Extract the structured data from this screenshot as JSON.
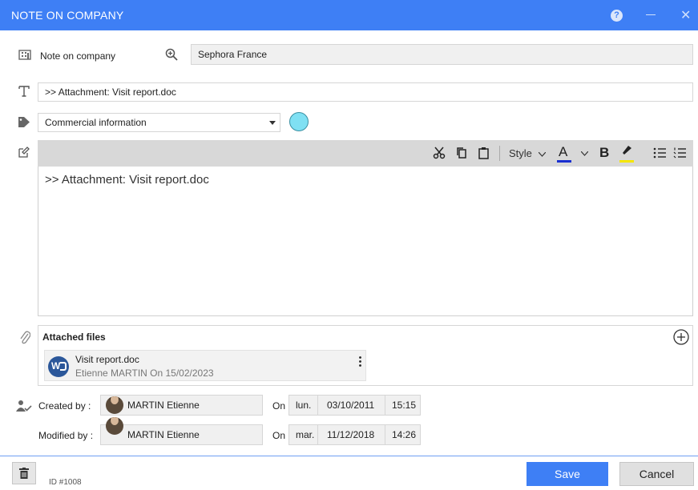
{
  "window": {
    "title": "NOTE ON COMPANY",
    "help_glyph": "?",
    "close_glyph": "✕"
  },
  "company": {
    "label": "Note on company",
    "value": "Sephora France"
  },
  "subject": {
    "value": ">> Attachment: Visit report.doc"
  },
  "category": {
    "value": "Commercial information",
    "color_swatch": "#7fe0f3"
  },
  "toolbar": {
    "style_label": "Style",
    "font_color_glyph": "A",
    "bold_glyph": "B",
    "font_color": "#1a2fd0",
    "highlight_color": "#f5e600"
  },
  "editor": {
    "content": ">> Attachment: Visit report.doc"
  },
  "attachments": {
    "header": "Attached files",
    "files": [
      {
        "name": "Visit report.doc",
        "meta": "Etienne MARTIN On 15/02/2023",
        "icon": "word-doc-icon",
        "icon_glyph": "W"
      }
    ]
  },
  "created": {
    "label": "Created by :",
    "user": "MARTIN Etienne",
    "on": "On",
    "day": "lun.",
    "date": "03/10/2011",
    "time": "15:15"
  },
  "modified": {
    "label": "Modified by :",
    "user": "MARTIN Etienne",
    "on": "On",
    "day": "mar.",
    "date": "11/12/2018",
    "time": "14:26"
  },
  "footer": {
    "id_label": "ID #1008",
    "save_label": "Save",
    "cancel_label": "Cancel"
  },
  "colors": {
    "accent": "#3e7ff5"
  }
}
